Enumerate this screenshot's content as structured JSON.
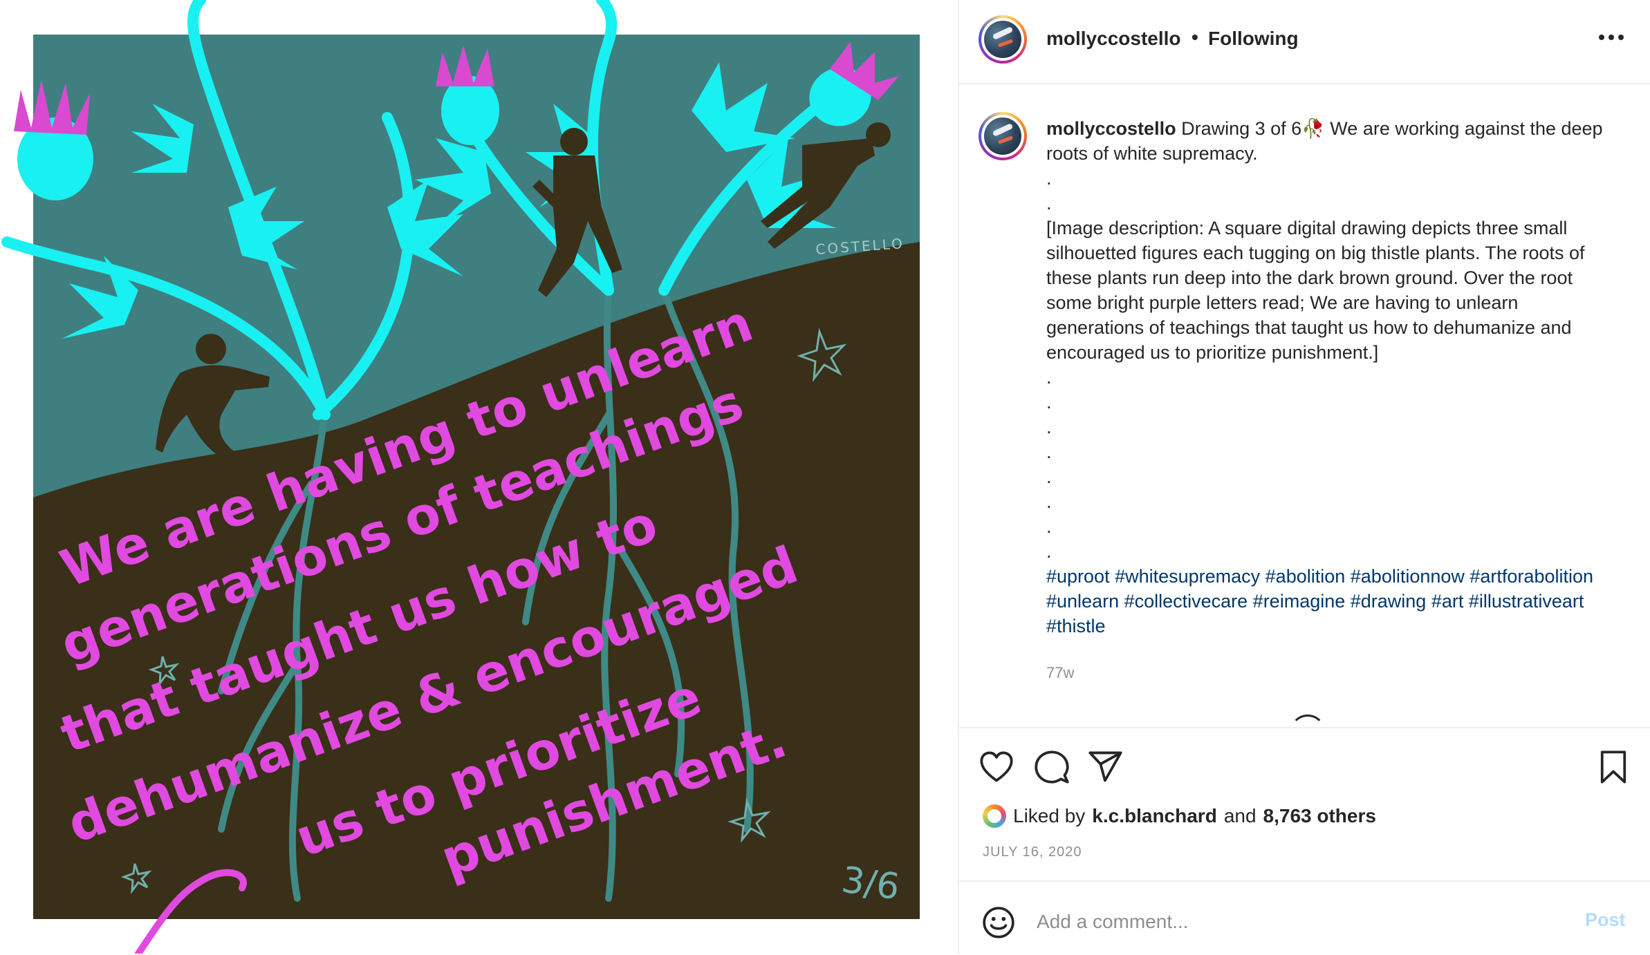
{
  "colors": {
    "ground": "#3a2f18",
    "sky": "#3f7f80",
    "plant": "#19f0f2",
    "flower": "#d94ad0",
    "lettering": "#e14ae0",
    "link": "#00376b",
    "post_disabled": "#b3dbff"
  },
  "artwork": {
    "signature": "COSTELLO",
    "page_number": "3/6",
    "lettering_lines": [
      "We are having to unlearn",
      "generations of teachings",
      "that taught us how to",
      "dehumanize & encouraged",
      "us to prioritize",
      "punishment."
    ]
  },
  "header": {
    "username": "mollyccostello",
    "separator": "•",
    "follow_status": "Following",
    "more_icon": "more-horizontal-icon"
  },
  "caption": {
    "username": "mollyccostello",
    "text": "Drawing 3 of 6🥀 We are working against the deep roots of white supremacy.",
    "dot": ".",
    "description": "[Image description: A square digital drawing depicts three small silhouetted figures each tugging on big thistle plants. The roots of these plants run deep into the dark brown ground. Over the root some bright purple letters read; We are having to unlearn generations of teachings that taught us how to dehumanize and encouraged us to prioritize punishment.]",
    "hashtags": "#uproot #whitesupremacy #abolition #abolitionnow #artforabolition #unlearn #collectivecare #reimagine #drawing #art #illustrativeart #thistle",
    "time_ago": "77w"
  },
  "actions": {
    "like_icon": "heart-icon",
    "comment_icon": "comment-icon",
    "share_icon": "share-icon",
    "save_icon": "bookmark-icon"
  },
  "likes": {
    "prefix": "Liked by",
    "user": "k.c.blanchard",
    "joiner": "and",
    "others": "8,763 others"
  },
  "date": "JULY 16, 2020",
  "comment": {
    "placeholder": "Add a comment...",
    "post_label": "Post"
  }
}
